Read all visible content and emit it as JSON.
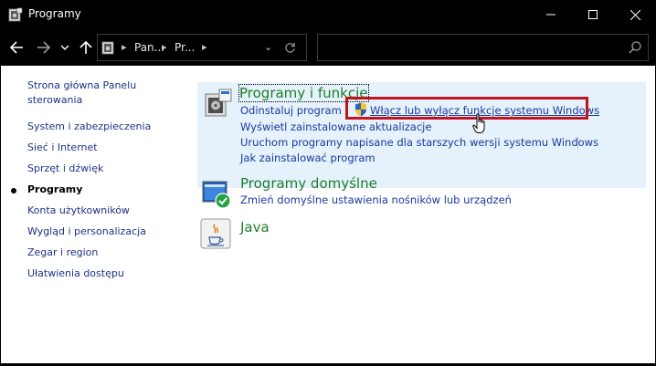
{
  "window": {
    "title": "Programy",
    "icons": [
      "control-panel-icon",
      "minimize-icon",
      "maximize-icon",
      "close-icon"
    ]
  },
  "navigation": {
    "breadcrumb": [
      "Pan...",
      "Pr..."
    ],
    "search_placeholder": "",
    "icons": [
      "back-arrow-icon",
      "forward-arrow-icon",
      "chevron-down-icon",
      "up-arrow-icon",
      "refresh-icon",
      "search-icon"
    ]
  },
  "sidebar": {
    "items": [
      "Strona główna Panelu sterowania",
      "System i zabezpieczenia",
      "Sieć i Internet",
      "Sprzęt i dźwięk",
      "Programy",
      "Konta użytkowników",
      "Wygląd i personalizacja",
      "Zegar i region",
      "Ułatwienia dostępu"
    ],
    "current": "Programy"
  },
  "categories": {
    "programs_features": {
      "title": "Programy i funkcje",
      "links": [
        "Odinstaluj program",
        "Włącz lub wyłącz funkcje systemu Windows",
        "Wyświetl zainstalowane aktualizacje",
        "Uruchom programy napisane dla starszych wersji systemu Windows",
        "Jak zainstalować program"
      ]
    },
    "default_programs": {
      "title": "Programy domyślne",
      "links": [
        "Zmień domyślne ustawienia nośników lub urządzeń"
      ]
    },
    "java": {
      "title": "Java"
    }
  },
  "colors": {
    "link": "#1a3aa0",
    "category_title": "#1e7d2b",
    "highlight": "#c01520",
    "panel_bg": "#e5f1fb"
  }
}
